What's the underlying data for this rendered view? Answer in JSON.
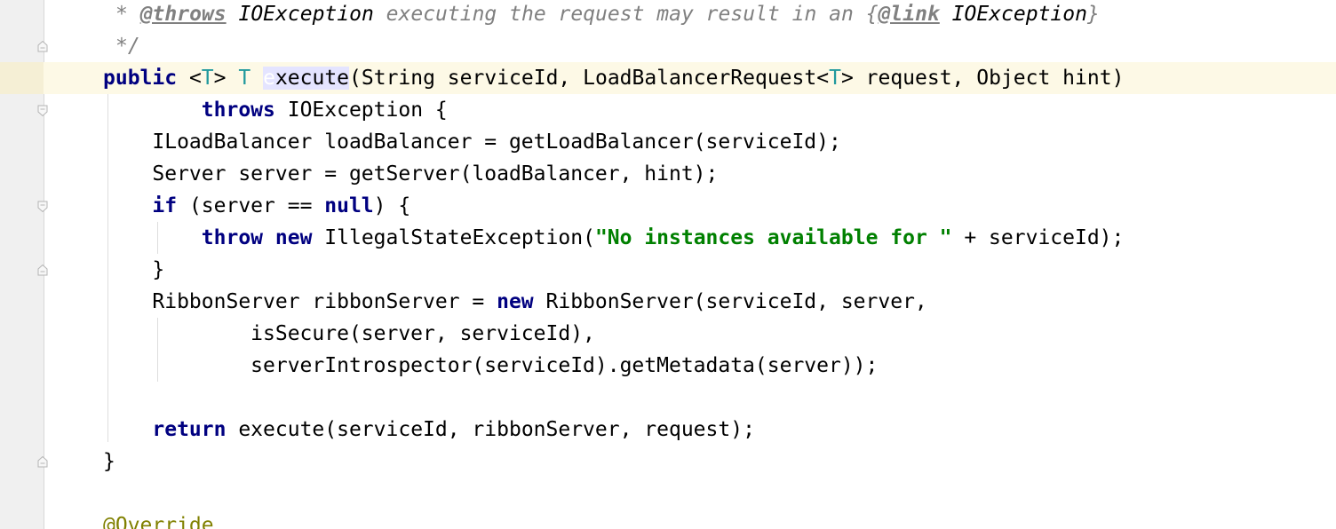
{
  "editor": {
    "language": "java",
    "caret_line": 3,
    "colors": {
      "keyword": "#000080",
      "string": "#008000",
      "type_param": "#20999d",
      "annotation": "#808000",
      "comment": "#808080",
      "current_line": "#fdf9e6",
      "gutter": "#f0f0f0"
    }
  },
  "lines": {
    "l1": {
      "a": "* ",
      "b": "@throws",
      "c": " IOException",
      "d": " executing the request may result in an {",
      "e": "@link",
      "f": " IOException",
      "g": "}"
    },
    "l2": {
      "a": "*/"
    },
    "l3": {
      "a": "public",
      "b": " <",
      "c": "T",
      "d": "> ",
      "e": "T",
      "f": " ",
      "g": "e",
      "h": "xecute",
      "i": "(String serviceId, LoadBalancerRequest<",
      "j": "T",
      "k": "> request, Object hint)"
    },
    "l4": {
      "a": "        ",
      "b": "throws",
      "c": " IOException {"
    },
    "l5": {
      "a": "    ILoadBalancer loadBalancer = getLoadBalancer(serviceId);"
    },
    "l6": {
      "a": "    Server server = getServer(loadBalancer, hint);"
    },
    "l7": {
      "a": "    ",
      "b": "if",
      "c": " (server == ",
      "d": "null",
      "e": ") {"
    },
    "l8": {
      "a": "        ",
      "b": "throw",
      "c": " ",
      "d": "new",
      "e": " IllegalStateException(",
      "f": "\"No instances available for \"",
      "g": " + serviceId);"
    },
    "l9": {
      "a": "    }"
    },
    "l10": {
      "a": "    RibbonServer ribbonServer = ",
      "b": "new",
      "c": " RibbonServer(serviceId, server,"
    },
    "l11": {
      "a": "            isSecure(server, serviceId),"
    },
    "l12": {
      "a": "            serverIntrospector(serviceId).getMetadata(server));"
    },
    "l13": {
      "a": ""
    },
    "l14": {
      "a": "    ",
      "b": "return",
      "c": " execute(serviceId, ribbonServer, request);"
    },
    "l15": {
      "a": "}"
    },
    "l16": {
      "a": ""
    },
    "l17": {
      "a": "@Override"
    }
  }
}
